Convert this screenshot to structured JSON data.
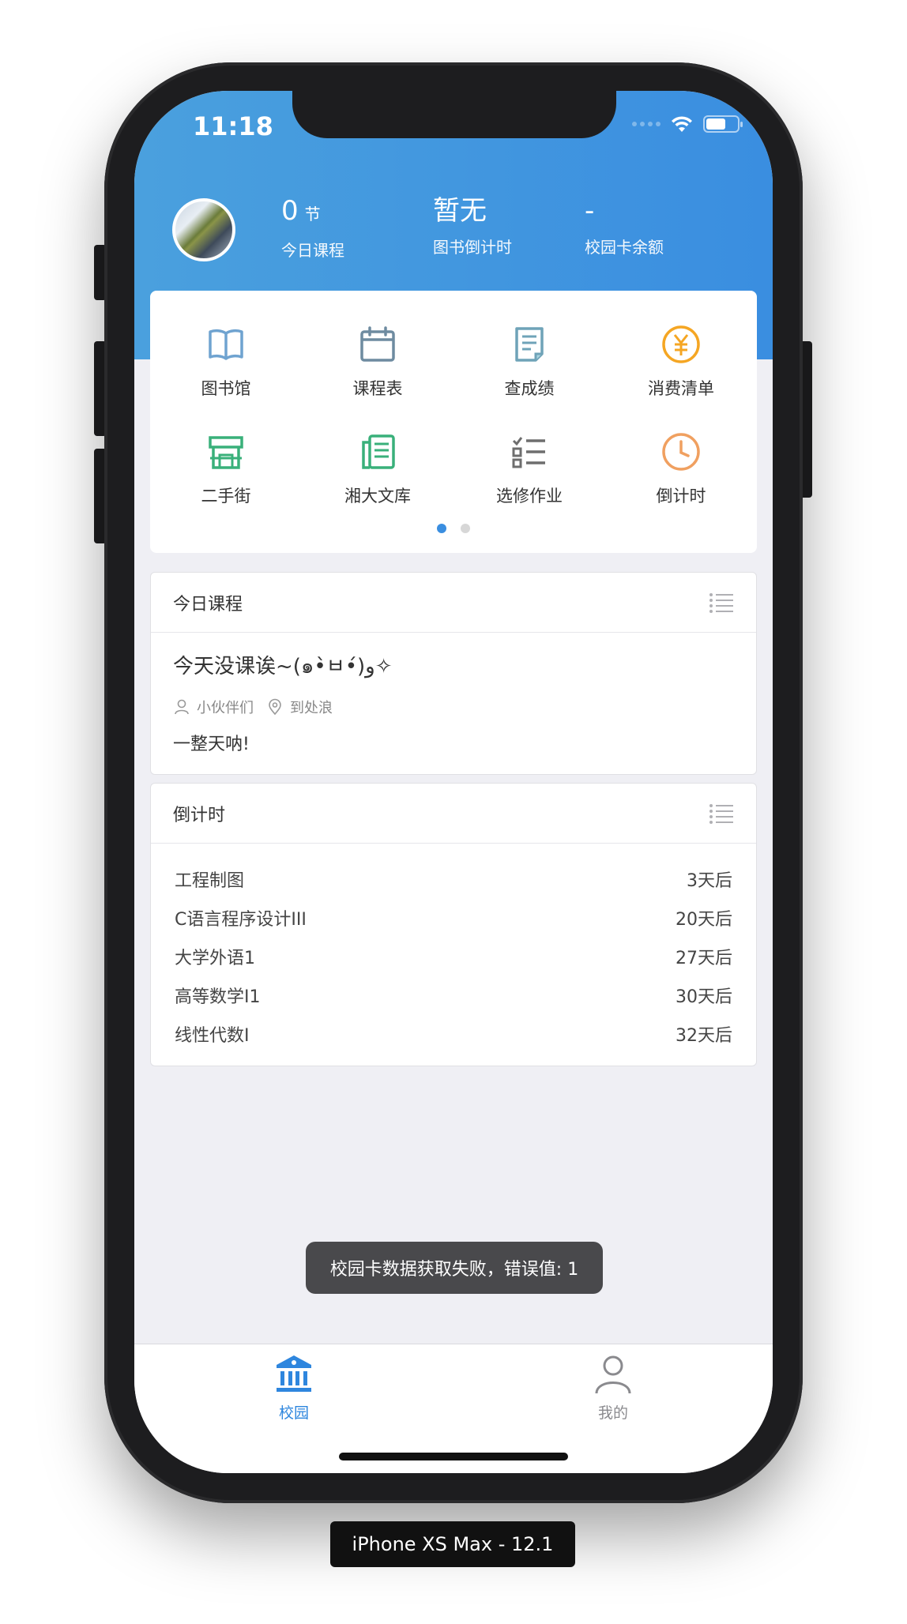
{
  "status": {
    "time": "11:18"
  },
  "header": {
    "stats": [
      {
        "value": "0",
        "unit": "节",
        "label": "今日课程"
      },
      {
        "value": "暂无",
        "unit": "",
        "label": "图书倒计时"
      },
      {
        "value": "-",
        "unit": "",
        "label": "校园卡余额"
      }
    ]
  },
  "grid": {
    "items": [
      {
        "label": "图书馆",
        "icon": "book-icon",
        "color": "#6fa3d0"
      },
      {
        "label": "课程表",
        "icon": "calendar-icon",
        "color": "#6e8ba0"
      },
      {
        "label": "查成绩",
        "icon": "report-icon",
        "color": "#6fa3b8"
      },
      {
        "label": "消费清单",
        "icon": "yen-coin-icon",
        "color": "#f5a623"
      },
      {
        "label": "二手街",
        "icon": "shop-icon",
        "color": "#39b07a"
      },
      {
        "label": "湘大文库",
        "icon": "documents-icon",
        "color": "#39b07a"
      },
      {
        "label": "选修作业",
        "icon": "checklist-icon",
        "color": "#6e6e6e"
      },
      {
        "label": "倒计时",
        "icon": "clock-icon",
        "color": "#f0a060"
      }
    ],
    "page_count": 2,
    "active_page": 1
  },
  "today_course": {
    "title": "今日课程",
    "course_title": "今天没课诶~(๑•̀ㅂ•́)و✧",
    "people": "小伙伴们",
    "location": "到处浪",
    "desc": "一整天呐!"
  },
  "countdown": {
    "title": "倒计时",
    "rows": [
      {
        "name": "工程制图",
        "when": "3天后"
      },
      {
        "name": "C语言程序设计III",
        "when": "20天后"
      },
      {
        "name": "大学外语1",
        "when": "27天后"
      },
      {
        "name": "高等数学Ⅰ1",
        "when": "30天后"
      },
      {
        "name": "线性代数Ⅰ",
        "when": "32天后"
      }
    ]
  },
  "toast": {
    "text": "校园卡数据获取失败，错误值: 1"
  },
  "tabbar": {
    "tabs": [
      {
        "label": "校园",
        "icon": "campus-icon",
        "active": true
      },
      {
        "label": "我的",
        "icon": "user-icon",
        "active": false
      }
    ]
  },
  "device_label": "iPhone XS Max - 12.1"
}
